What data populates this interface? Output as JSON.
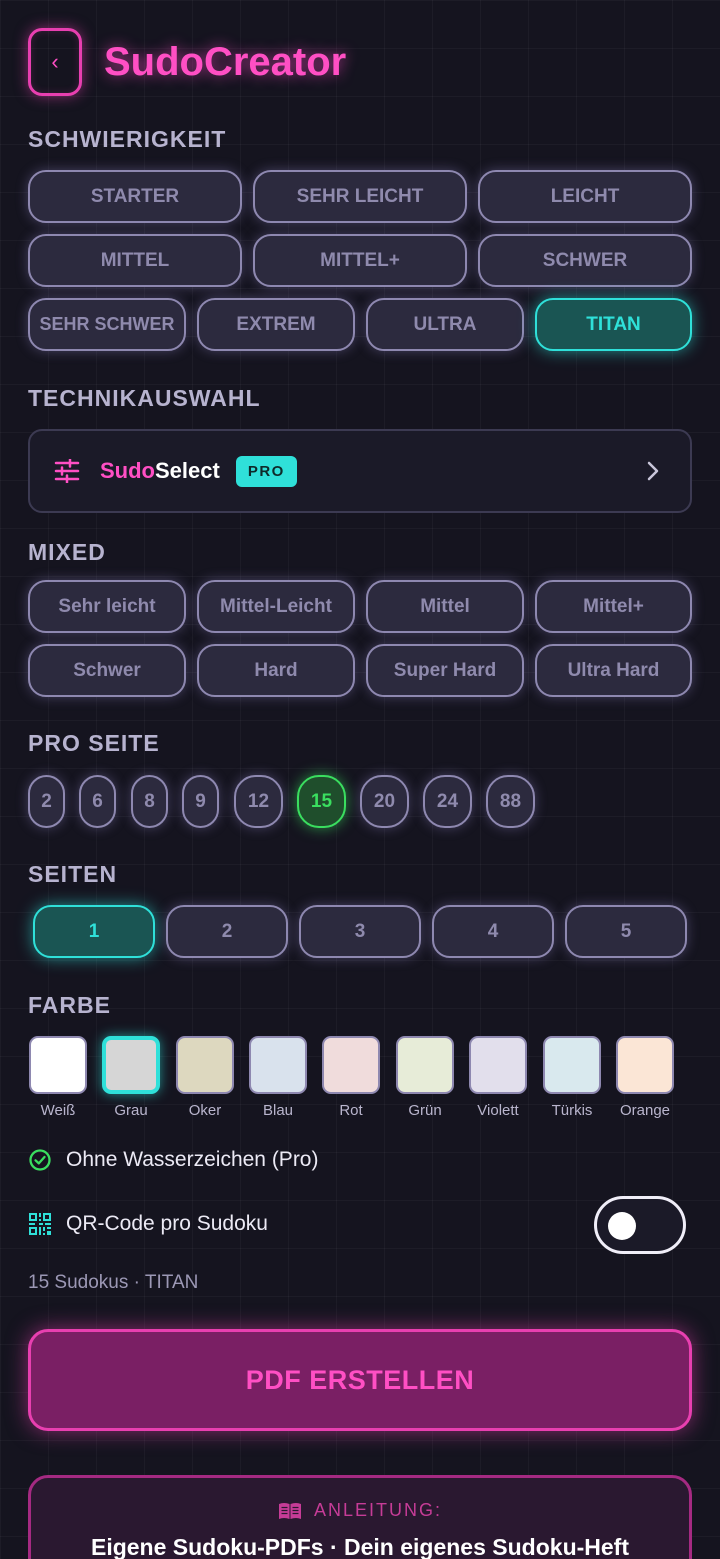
{
  "header": {
    "back_icon": "chevron-left-icon",
    "title": "SudoCreator"
  },
  "difficulty": {
    "label": "SCHWIERIGKEIT",
    "options": [
      "STARTER",
      "SEHR LEICHT",
      "LEICHT",
      "MITTEL",
      "MITTEL+",
      "SCHWER",
      "SEHR SCHWER",
      "EXTREM",
      "ULTRA",
      "TITAN"
    ],
    "selected": "TITAN"
  },
  "technique": {
    "label": "TECHNIKAUSWAHL",
    "icon": "sliders-icon",
    "name_part1": "Sudo",
    "name_part2": "Select",
    "badge": "PRO",
    "chevron": "chevron-right-icon"
  },
  "mixed": {
    "label": "MIXED",
    "options": [
      "Sehr leicht",
      "Mittel-Leicht",
      "Mittel",
      "Mittel+",
      "Schwer",
      "Hard",
      "Super Hard",
      "Ultra Hard"
    ]
  },
  "per_page": {
    "label": "PRO SEITE",
    "options": [
      "2",
      "6",
      "8",
      "9",
      "12",
      "15",
      "20",
      "24",
      "88"
    ],
    "selected": "15"
  },
  "pages": {
    "label": "SEITEN",
    "options": [
      "1",
      "2",
      "3",
      "4",
      "5"
    ],
    "selected": "1"
  },
  "color": {
    "label": "FARBE",
    "swatches": [
      {
        "name": "Weiß",
        "hex": "#ffffff"
      },
      {
        "name": "Grau",
        "hex": "#d6d6d6"
      },
      {
        "name": "Oker",
        "hex": "#ddd8bf"
      },
      {
        "name": "Blau",
        "hex": "#d9e2ed"
      },
      {
        "name": "Rot",
        "hex": "#f0dcdc"
      },
      {
        "name": "Grün",
        "hex": "#e7ecd8"
      },
      {
        "name": "Violett",
        "hex": "#e2dfec"
      },
      {
        "name": "Türkis",
        "hex": "#d9e9ee"
      },
      {
        "name": "Orange",
        "hex": "#fbe6d6"
      }
    ],
    "selected": "Grau"
  },
  "options": {
    "watermark": {
      "icon": "check-circle-icon",
      "label": "Ohne Wasserzeichen (Pro)"
    },
    "qr": {
      "icon": "qr-code-icon",
      "label": "QR-Code pro Sudoku",
      "enabled": false
    }
  },
  "summary": "15 Sudokus · TITAN",
  "create_button": "PDF ERSTELLEN",
  "guide": {
    "icon": "book-icon",
    "heading": "ANLEITUNG:",
    "text": "Eigene Sudoku-PDFs · Dein eigenes Sudoku-Heft"
  }
}
